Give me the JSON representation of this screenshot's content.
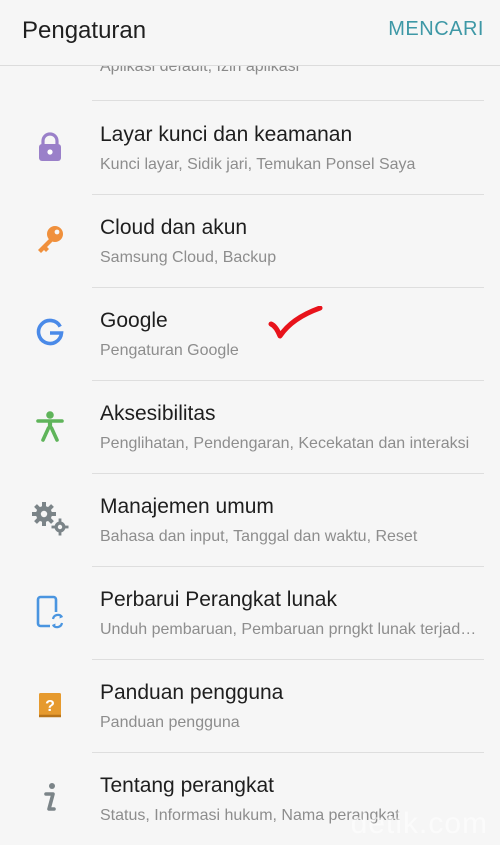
{
  "header": {
    "title": "Pengaturan",
    "search_label": "MENCARI"
  },
  "partial_item": {
    "subtitle": "Aplikasi default, Izin aplikasi"
  },
  "items": [
    {
      "id": "lock",
      "label": "Layar kunci dan keamanan",
      "subtitle": "Kunci layar, Sidik jari, Temukan Ponsel Saya",
      "icon": "lock-icon",
      "color": "#9a80c9"
    },
    {
      "id": "cloud",
      "label": "Cloud dan akun",
      "subtitle": "Samsung Cloud, Backup",
      "icon": "key-icon",
      "color": "#f0903c"
    },
    {
      "id": "google",
      "label": "Google",
      "subtitle": "Pengaturan Google",
      "icon": "google-icon",
      "color": "#4a8ae8"
    },
    {
      "id": "access",
      "label": "Aksesibilitas",
      "subtitle": "Penglihatan, Pendengaran, Kecekatan dan interaksi",
      "icon": "accessibility-icon",
      "color": "#5fb45a"
    },
    {
      "id": "general",
      "label": "Manajemen umum",
      "subtitle": "Bahasa dan input, Tanggal dan waktu, Reset",
      "icon": "gears-icon",
      "color": "#7b8488"
    },
    {
      "id": "update",
      "label": "Perbarui Perangkat lunak",
      "subtitle": "Unduh pembaruan, Pembaruan prngkt lunak terjadwal",
      "icon": "software-update-icon",
      "color": "#4a95e0"
    },
    {
      "id": "manual",
      "label": "Panduan pengguna",
      "subtitle": "Panduan pengguna",
      "icon": "user-manual-icon",
      "color": "#e69a2e"
    },
    {
      "id": "about",
      "label": "Tentang perangkat",
      "subtitle": "Status, Informasi hukum, Nama perangkat",
      "icon": "info-icon",
      "color": "#7b8488"
    }
  ],
  "annotation_color": "#e8131b",
  "watermark": "detik.com"
}
